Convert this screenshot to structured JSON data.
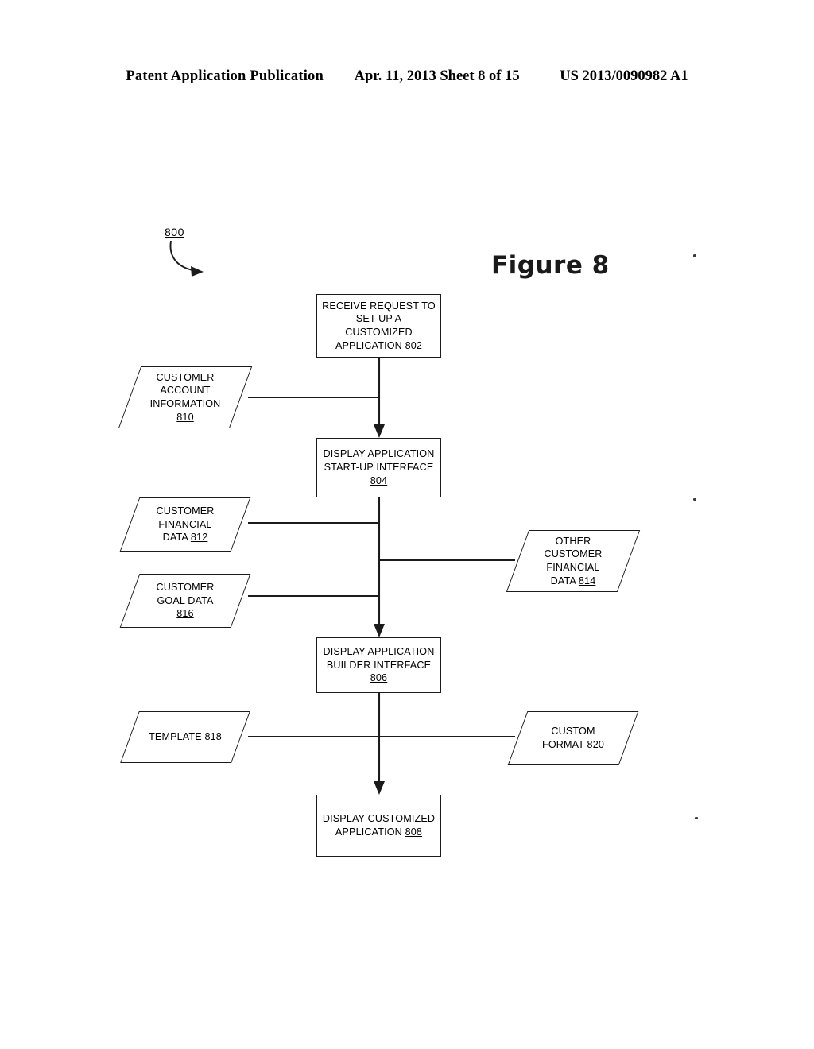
{
  "header": {
    "publication": "Patent Application Publication",
    "date_sheet": "Apr. 11, 2013  Sheet 8 of 15",
    "patent_number": "US 2013/0090982 A1"
  },
  "figure": {
    "title": "Figure 8",
    "reference_numeral": "800"
  },
  "flowchart": {
    "process_nodes": [
      {
        "id": "802",
        "lines": [
          "RECEIVE REQUEST TO",
          "SET UP A CUSTOMIZED",
          "APPLICATION"
        ],
        "number": "802"
      },
      {
        "id": "804",
        "lines": [
          "DISPLAY APPLICATION",
          "START-UP INTERFACE"
        ],
        "number": "804"
      },
      {
        "id": "806",
        "lines": [
          "DISPLAY APPLICATION",
          "BUILDER INTERFACE"
        ],
        "number": "806"
      },
      {
        "id": "808",
        "lines": [
          "DISPLAY CUSTOMIZED",
          "APPLICATION"
        ],
        "number": "808"
      }
    ],
    "data_nodes": [
      {
        "id": "810",
        "lines": [
          "CUSTOMER",
          "ACCOUNT",
          "INFORMATION"
        ],
        "number": "810",
        "number_on_own_line": true,
        "side": "left"
      },
      {
        "id": "812",
        "lines": [
          "CUSTOMER",
          "FINANCIAL",
          "DATA"
        ],
        "number": "812",
        "number_on_own_line": false,
        "side": "left"
      },
      {
        "id": "816",
        "lines": [
          "CUSTOMER",
          "GOAL DATA"
        ],
        "number": "816",
        "number_on_own_line": true,
        "side": "left"
      },
      {
        "id": "814",
        "lines": [
          "OTHER",
          "CUSTOMER",
          "FINANCIAL",
          "DATA"
        ],
        "number": "814",
        "number_on_own_line": false,
        "side": "right"
      },
      {
        "id": "818",
        "lines": [
          "TEMPLATE"
        ],
        "number": "818",
        "number_on_own_line": false,
        "side": "left"
      },
      {
        "id": "820",
        "lines": [
          "CUSTOM",
          "FORMAT"
        ],
        "number": "820",
        "number_on_own_line": false,
        "side": "right"
      }
    ]
  },
  "colors": {
    "ink": "#1b1b1b",
    "paper": "#ffffff"
  }
}
